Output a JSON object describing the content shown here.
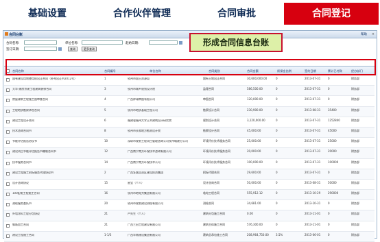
{
  "nav": {
    "tabs": [
      {
        "label": "基础设置",
        "active": false
      },
      {
        "label": "合作伙伴管理",
        "active": false
      },
      {
        "label": "合同审批",
        "active": false
      },
      {
        "label": "合同登记",
        "active": true
      }
    ],
    "active_color": "#d7000f"
  },
  "panel": {
    "title": "合同台账",
    "help": "帮助",
    "close": "×"
  },
  "filter": {
    "contract_name_label": "合同名称:",
    "unit_name_label": "单位名称:",
    "sign_date_label": "起始日期:",
    "dept_label": "签订日期:",
    "search_btn": "查询",
    "more_btn": "更多查询"
  },
  "callout": "形成合同信息台账",
  "table": {
    "headers": [
      "合同名称",
      "合同编号",
      "单位名称",
      "合同类别",
      "合同金额",
      "质保金比例",
      "签约日期",
      "累计已付款",
      "经办部门"
    ],
    "rows": [
      [
        "国有建设用地使用权出让合同（补充出让书2012号）",
        "1",
        "钦州市国土资源局",
        "国有土地出让合同",
        "30,600,000.00",
        "0",
        "2013-07-31",
        "0",
        "财务部"
      ],
      [
        "大华·建房京建工程建筑装修合同",
        "3",
        "钦州市城乡规划设计院",
        "监理合同",
        "586,500.00",
        "0",
        "2013-07-31",
        "0",
        "财务部"
      ],
      [
        "房屋建筑工程施工图审查合同",
        "4",
        "广西祥瑞审图有限公司",
        "审图合同",
        "120,000.00",
        "0",
        "2013-07-31",
        "0",
        "财务部"
      ],
      [
        "工程地质勘察承包合同",
        "5",
        "钦州市地质基础工程公司",
        "勘察设计合同",
        "230,900.00",
        "0",
        "2013-08-31",
        "35400",
        "财务部"
      ],
      [
        "建设工程设计合同",
        "6",
        "福建省福州大学土木建筑设计研究院",
        "规划设计合同",
        "3,120,000.00",
        "0",
        "2013-07-31",
        "1252840",
        "财务部"
      ],
      [
        "技术咨询合同书",
        "8",
        "钦州市长和地方勘测设计院",
        "勘察设计合同",
        "45,000.00",
        "0",
        "2013-07-31",
        "45000",
        "财务部"
      ],
      [
        "节能评估报告协议书",
        "10",
        "深圳市规划工程项目管理咨询公司钦州城建分公司",
        "环境评价技术服务合同",
        "25,000.00",
        "0",
        "2013-07-31",
        "25000",
        "财务部"
      ],
      [
        "建设项目节能评估报告书编制合同书",
        "12",
        "广西南宁南方环保技术咨询有限公司",
        "环境评价技术服务合同",
        "20,000.00",
        "0",
        "2013-07-31",
        "20000",
        "财务部"
      ],
      [
        "技术服务合同书",
        "14",
        "广西南宁南方环保技术公司",
        "环境评价技术服务合同",
        "100,000.00",
        "0",
        "2013-07-31",
        "100000",
        "财务部"
      ],
      [
        "建设工程施工招标服务代理协议书",
        "2",
        "广西壮族自治区建设投资集团",
        "招标代理合同",
        "29,600.00",
        "0",
        "2013-07-31",
        "0",
        "财务部"
      ],
      [
        "设计咨询协议",
        "15",
        "星宝（个人）",
        "设计咨询合同",
        "50,000.00",
        "0",
        "2013-08-31",
        "50000",
        "财务部"
      ],
      [
        "100配电工程施工合同",
        "16",
        "钦州市地电力集团有限公司",
        "临电工程合同",
        "555,912.12",
        "0",
        "2013-10-29",
        "290000",
        "财务部"
      ],
      [
        "测绘服务委托书",
        "20",
        "钦州市规划建设测绘有限公司",
        "测绘合同",
        "34,681.00",
        "0",
        "2013-10-31",
        "0",
        "财务部"
      ],
      [
        "外墙涂料工程分包协议",
        "21",
        "严先生（个人）",
        "建筑分包施工合同",
        "0.00",
        "0",
        "2013-11-01",
        "0",
        "财务部"
      ],
      [
        "钢筋加工合同",
        "21",
        "广西三田工程建设有限公司",
        "建筑主体施工合同",
        "576,300.00",
        "0",
        "2013-11-01",
        "0",
        "财务部"
      ],
      [
        "建设工程施工合同",
        "1-1/3",
        "广西华南建设集团有限公司",
        "建筑总承包施工合同",
        "208,964,750.00",
        "3.5%",
        "2013-06-01",
        "0",
        "财务部"
      ]
    ]
  }
}
